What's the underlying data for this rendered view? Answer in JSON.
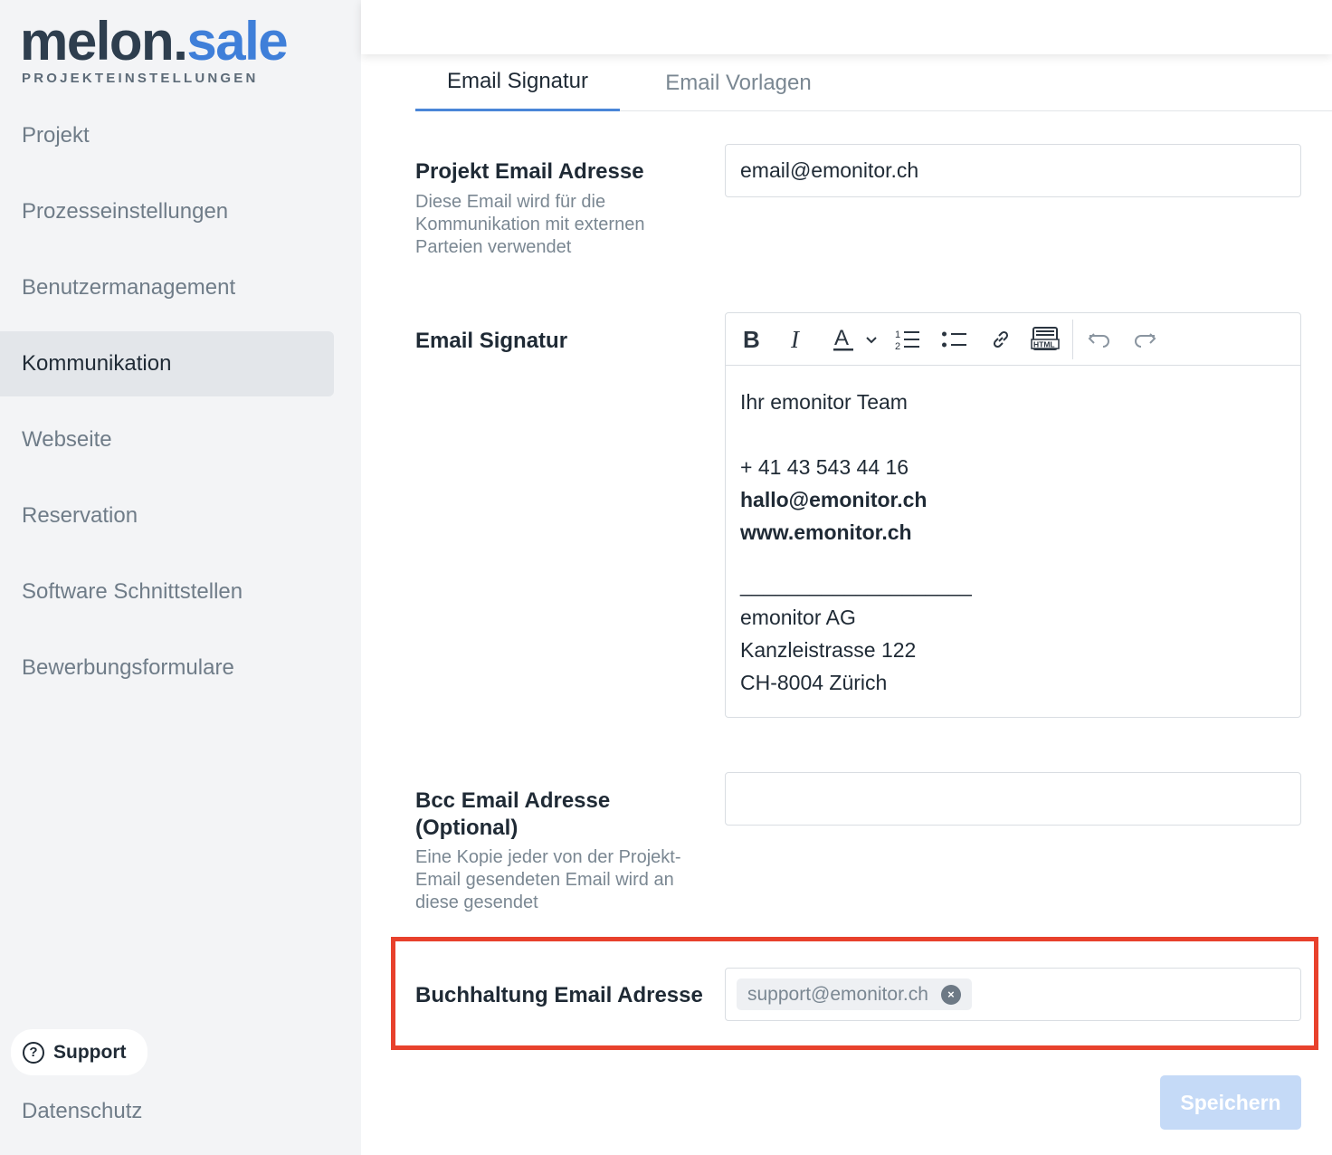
{
  "brand": {
    "name_part1": "melon",
    "name_dot": ".",
    "name_part2": "sale",
    "subtitle": "PROJEKTEINSTELLUNGEN"
  },
  "sidebar": {
    "items": [
      {
        "label": "Projekt",
        "active": false
      },
      {
        "label": "Prozesseinstellungen",
        "active": false
      },
      {
        "label": "Benutzermanagement",
        "active": false
      },
      {
        "label": "Kommunikation",
        "active": true
      },
      {
        "label": "Webseite",
        "active": false
      },
      {
        "label": "Reservation",
        "active": false
      },
      {
        "label": "Software Schnittstellen",
        "active": false
      },
      {
        "label": "Bewerbungsformulare",
        "active": false
      }
    ],
    "support_label": "Support",
    "support_icon": "question-circle-icon",
    "privacy_label": "Datenschutz"
  },
  "tabs": [
    {
      "label": "Email Signatur",
      "active": true
    },
    {
      "label": "Email Vorlagen",
      "active": false
    }
  ],
  "form": {
    "project_email": {
      "label": "Projekt Email Adresse",
      "description": "Diese Email wird für die Kommunikation mit externen Parteien verwendet",
      "value": "email@emonitor.ch"
    },
    "signature": {
      "label": "Email Signatur",
      "toolbar": [
        "bold-icon",
        "italic-icon",
        "text-color-icon",
        "chevron-down-icon",
        "ordered-list-icon",
        "bullet-list-icon",
        "link-icon",
        "html-icon",
        "undo-icon",
        "redo-icon"
      ],
      "lines": {
        "l1": "Ihr emonitor Team",
        "l2": "+ 41 43 543 44 16",
        "l3": "hallo@emonitor.ch",
        "l4": "www.emonitor.ch",
        "l5": "____________________",
        "l6": "emonitor AG",
        "l7": "Kanzleistrasse 122",
        "l8": "CH-8004 Zürich"
      }
    },
    "bcc_email": {
      "label": "Bcc Email Adresse (Optional)",
      "description": "Eine Kopie jeder von der Projekt-Email gesendeten Email wird an diese gesendet",
      "value": ""
    },
    "accounting_email": {
      "label": "Buchhaltung Email Adresse",
      "chips": [
        "support@emonitor.ch"
      ],
      "remove_symbol": "×"
    }
  },
  "actions": {
    "save_label": "Speichern"
  },
  "colors": {
    "accent": "#3f7fd9",
    "highlight": "#e8412c",
    "sidebar_bg": "#f3f4f6",
    "save_disabled": "#c5daf7"
  }
}
